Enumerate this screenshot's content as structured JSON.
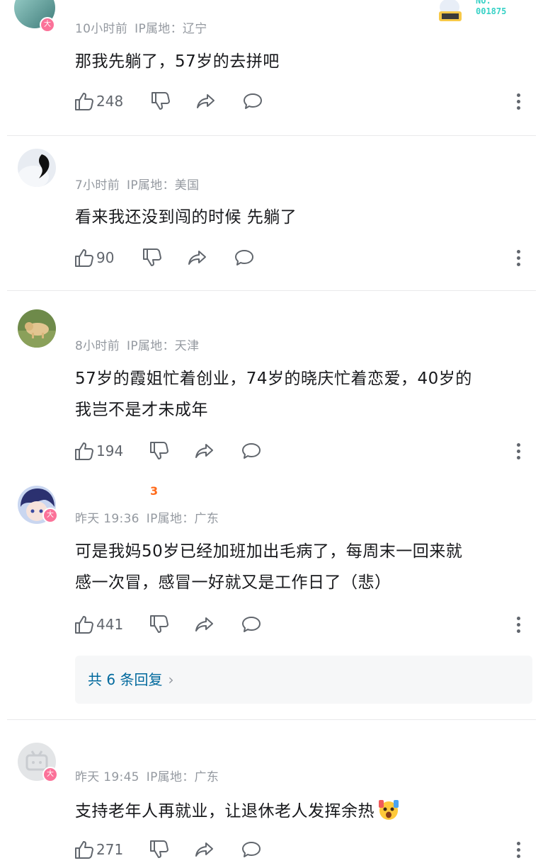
{
  "comments": [
    {
      "time": "10小时前",
      "ip": "IP属地：辽宁",
      "text_lines": [
        "那我先躺了，57岁的去拼吧"
      ],
      "likes": "248",
      "badge": "大",
      "deco_number": "NO.\n001875"
    },
    {
      "time": "7小时前",
      "ip": "IP属地：美国",
      "text_lines": [
        "看来我还没到闯的时候 先躺了"
      ],
      "likes": "90"
    },
    {
      "time": "8小时前",
      "ip": "IP属地：天津",
      "text_lines": [
        "57岁的霞姐忙着创业，74岁的晓庆忙着恋爱，40岁的",
        "我岂不是才未成年"
      ],
      "likes": "194"
    },
    {
      "time": "昨天 19:36",
      "ip": "IP属地：广东",
      "text_lines": [
        "可是我妈50岁已经加班加出毛病了，每周末一回来就",
        "感一次冒，感冒一好就又是工作日了（悲）"
      ],
      "likes": "441",
      "badge": "大",
      "level_mark": "3",
      "replies": "共 6 条回复"
    },
    {
      "time": "昨天 19:45",
      "ip": "IP属地：广东",
      "text_lines": [
        "支持老年人再就业，让退休老人发挥余热"
      ],
      "likes": "271",
      "badge": "大"
    }
  ],
  "icons": {
    "like": "thumb-up-icon",
    "dislike": "thumb-down-icon",
    "share": "share-icon",
    "reply": "comment-bubble-icon",
    "more": "more-vertical-icon",
    "emoji": "shocked-face-emoji"
  },
  "colors": {
    "meta": "#9499a0",
    "text": "#18191c",
    "reply_link": "#00699d",
    "badge": "#fb7299"
  }
}
